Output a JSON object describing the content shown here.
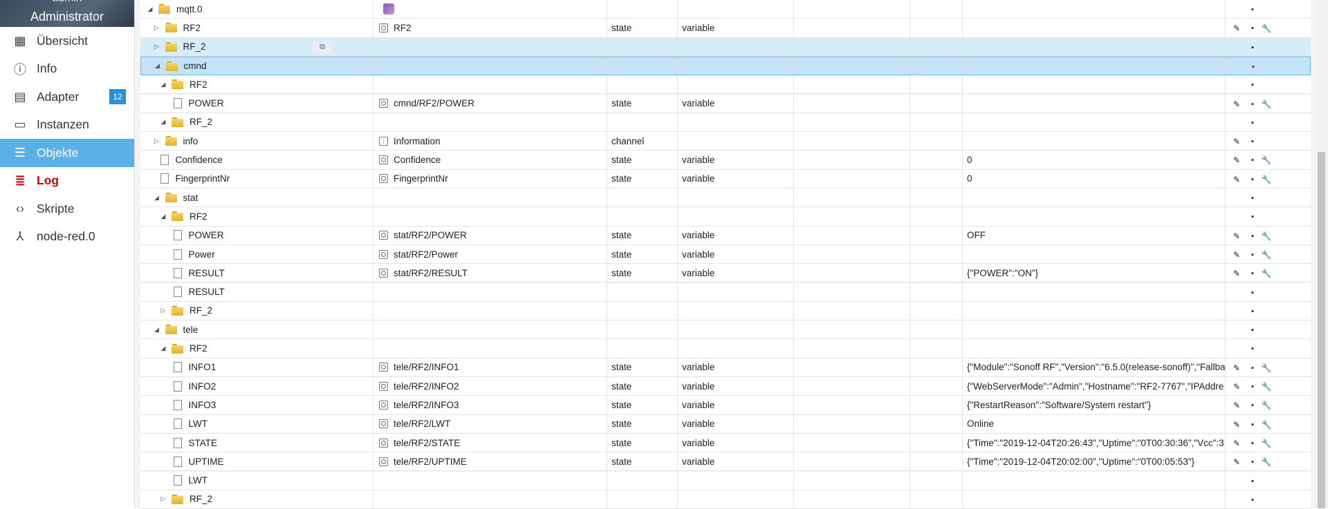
{
  "user": {
    "name": "admin",
    "role": "Administrator"
  },
  "nav": [
    {
      "id": "uebersicht",
      "label": "Übersicht",
      "icon": "grid-icon"
    },
    {
      "id": "info",
      "label": "Info",
      "icon": "info-icon"
    },
    {
      "id": "adapter",
      "label": "Adapter",
      "icon": "store-icon",
      "badge": "12"
    },
    {
      "id": "instanzen",
      "label": "Instanzen",
      "icon": "instances-icon"
    },
    {
      "id": "objekte",
      "label": "Objekte",
      "icon": "list-icon",
      "active": true
    },
    {
      "id": "log",
      "label": "Log",
      "icon": "log-icon"
    },
    {
      "id": "skripte",
      "label": "Skripte",
      "icon": "code-icon"
    },
    {
      "id": "nodered",
      "label": "node-red.0",
      "icon": "node-icon"
    }
  ],
  "rows": [
    {
      "name": "mqtt.0",
      "level": 0,
      "kind": "folder",
      "expanded": true,
      "title": "",
      "logo": true,
      "type": "",
      "role": "",
      "value": "",
      "actions": [
        "del"
      ]
    },
    {
      "name": "RF2",
      "level": 1,
      "kind": "folder",
      "expanded": false,
      "title": "RF2",
      "titleIcon": "state",
      "type": "state",
      "role": "variable",
      "value": "",
      "actions": [
        "edit",
        "del",
        "set"
      ]
    },
    {
      "name": "RF_2",
      "level": 1,
      "kind": "folder",
      "expanded": false,
      "title": "",
      "type": "",
      "role": "",
      "value": "",
      "actions": [
        "del"
      ],
      "hl": true,
      "copy": true
    },
    {
      "name": "cmnd",
      "level": 1,
      "kind": "folder",
      "expanded": true,
      "title": "",
      "type": "",
      "role": "",
      "value": "",
      "actions": [
        "del"
      ],
      "sel": true
    },
    {
      "name": "RF2",
      "level": 2,
      "kind": "folder",
      "expanded": true,
      "title": "",
      "type": "",
      "role": "",
      "value": "",
      "actions": [
        "del"
      ]
    },
    {
      "name": "POWER",
      "level": 3,
      "kind": "file",
      "title": "cmnd/RF2/POWER",
      "titleIcon": "state",
      "type": "state",
      "role": "variable",
      "value": "",
      "actions": [
        "edit",
        "del",
        "set"
      ]
    },
    {
      "name": "RF_2",
      "level": 2,
      "kind": "folder",
      "expanded": true,
      "title": "",
      "type": "",
      "role": "",
      "value": "",
      "actions": [
        "del"
      ]
    },
    {
      "name": "info",
      "level": 1,
      "kind": "folder",
      "expanded": false,
      "title": "Information",
      "titleIcon": "channel",
      "type": "channel",
      "role": "",
      "value": "",
      "actions": [
        "edit",
        "del"
      ]
    },
    {
      "name": "Confidence",
      "level": 1,
      "kind": "file",
      "title": "Confidence",
      "titleIcon": "state",
      "type": "state",
      "role": "variable",
      "value": "0",
      "actions": [
        "edit",
        "del",
        "set"
      ]
    },
    {
      "name": "FingerprintNr",
      "level": 1,
      "kind": "file",
      "title": "FingerprintNr",
      "titleIcon": "state",
      "type": "state",
      "role": "variable",
      "value": "0",
      "actions": [
        "edit",
        "del",
        "set"
      ]
    },
    {
      "name": "stat",
      "level": 1,
      "kind": "folder",
      "expanded": true,
      "title": "",
      "type": "",
      "role": "",
      "value": "",
      "actions": [
        "del"
      ]
    },
    {
      "name": "RF2",
      "level": 2,
      "kind": "folder",
      "expanded": true,
      "title": "",
      "type": "",
      "role": "",
      "value": "",
      "actions": [
        "del"
      ]
    },
    {
      "name": "POWER",
      "level": 3,
      "kind": "file",
      "title": "stat/RF2/POWER",
      "titleIcon": "state",
      "type": "state",
      "role": "variable",
      "value": "OFF",
      "actions": [
        "edit",
        "del",
        "set"
      ]
    },
    {
      "name": "Power",
      "level": 3,
      "kind": "file",
      "title": "stat/RF2/Power",
      "titleIcon": "state",
      "type": "state",
      "role": "variable",
      "value": "",
      "actions": [
        "edit",
        "del",
        "set"
      ]
    },
    {
      "name": "RESULT",
      "level": 3,
      "kind": "file",
      "title": "stat/RF2/RESULT",
      "titleIcon": "state",
      "type": "state",
      "role": "variable",
      "value": "{\"POWER\":\"ON\"}",
      "actions": [
        "edit",
        "del",
        "set"
      ]
    },
    {
      "name": "RESULT",
      "level": 3,
      "kind": "file",
      "title": "",
      "type": "",
      "role": "",
      "value": "",
      "actions": [
        "del"
      ]
    },
    {
      "name": "RF_2",
      "level": 2,
      "kind": "folder",
      "expanded": false,
      "title": "",
      "type": "",
      "role": "",
      "value": "",
      "actions": [
        "del"
      ]
    },
    {
      "name": "tele",
      "level": 1,
      "kind": "folder",
      "expanded": true,
      "title": "",
      "type": "",
      "role": "",
      "value": "",
      "actions": [
        "del"
      ]
    },
    {
      "name": "RF2",
      "level": 2,
      "kind": "folder",
      "expanded": true,
      "title": "",
      "type": "",
      "role": "",
      "value": "",
      "actions": [
        "del"
      ]
    },
    {
      "name": "INFO1",
      "level": 3,
      "kind": "file",
      "title": "tele/RF2/INFO1",
      "titleIcon": "state",
      "type": "state",
      "role": "variable",
      "value": "{\"Module\":\"Sonoff RF\",\"Version\":\"6.5.0(release-sonoff)\",\"Fallba",
      "actions": [
        "edit",
        "del",
        "set"
      ]
    },
    {
      "name": "INFO2",
      "level": 3,
      "kind": "file",
      "title": "tele/RF2/INFO2",
      "titleIcon": "state",
      "type": "state",
      "role": "variable",
      "value": "{\"WebServerMode\":\"Admin\",\"Hostname\":\"RF2-7767\",\"IPAddre",
      "actions": [
        "edit",
        "del",
        "set"
      ]
    },
    {
      "name": "INFO3",
      "level": 3,
      "kind": "file",
      "title": "tele/RF2/INFO3",
      "titleIcon": "state",
      "type": "state",
      "role": "variable",
      "value": "{\"RestartReason\":\"Software/System restart\"}",
      "actions": [
        "edit",
        "del",
        "set"
      ]
    },
    {
      "name": "LWT",
      "level": 3,
      "kind": "file",
      "title": "tele/RF2/LWT",
      "titleIcon": "state",
      "type": "state",
      "role": "variable",
      "value": "Online",
      "actions": [
        "edit",
        "del",
        "set"
      ]
    },
    {
      "name": "STATE",
      "level": 3,
      "kind": "file",
      "title": "tele/RF2/STATE",
      "titleIcon": "state",
      "type": "state",
      "role": "variable",
      "value": "{\"Time\":\"2019-12-04T20:26:43\",\"Uptime\":\"0T00:30:36\",\"Vcc\":3",
      "actions": [
        "edit",
        "del",
        "set"
      ]
    },
    {
      "name": "UPTIME",
      "level": 3,
      "kind": "file",
      "title": "tele/RF2/UPTIME",
      "titleIcon": "state",
      "type": "state",
      "role": "variable",
      "value": "{\"Time\":\"2019-12-04T20:02:00\",\"Uptime\":\"0T00:05:53\"}",
      "actions": [
        "edit",
        "del",
        "set"
      ]
    },
    {
      "name": "LWT",
      "level": 3,
      "kind": "file",
      "title": "",
      "type": "",
      "role": "",
      "value": "",
      "actions": [
        "del"
      ]
    },
    {
      "name": "RF_2",
      "level": 2,
      "kind": "folder",
      "expanded": false,
      "title": "",
      "type": "",
      "role": "",
      "value": "",
      "actions": [
        "del"
      ]
    }
  ]
}
